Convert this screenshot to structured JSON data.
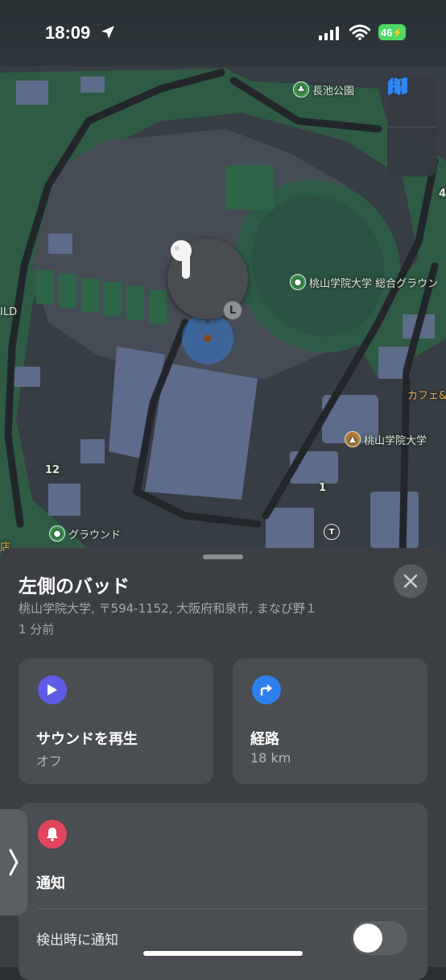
{
  "status_bar": {
    "time": "18:09",
    "battery": "46"
  },
  "map": {
    "labels": {
      "park": "長池公園",
      "sports": "桃山学院大学 総合グラウン",
      "field_left": "ILD",
      "cafe": "カフェ&",
      "univ": "桃山学院大学",
      "num12": "12",
      "num1": "1",
      "num4": "4",
      "ground": "グラウンド",
      "edge": "店"
    },
    "device_side": "L"
  },
  "sheet": {
    "title": "左側のバッド",
    "address": "桃山学院大学, 〒594-1152, 大阪府和泉市, まなび野１",
    "time_ago": "1 分前"
  },
  "actions": {
    "sound": {
      "title": "サウンドを再生",
      "subtitle": "オフ",
      "color": "#5e5ce6"
    },
    "route": {
      "title": "経路",
      "subtitle": "18 km",
      "color": "#2f80ed"
    }
  },
  "notify": {
    "title": "通知",
    "row_label": "検出時に通知",
    "toggle_on": false,
    "color": "#e0455b"
  }
}
